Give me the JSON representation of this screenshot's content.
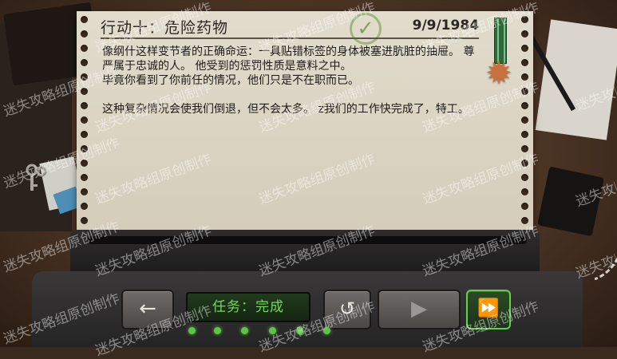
{
  "document": {
    "title": "行动十：危险药物",
    "date": "9/9/1984",
    "paragraphs": [
      "像纲什这样变节者的正确命运：一具贴错标签的身体被塞进肮脏的抽屉。 尊严属于忠诚的人。 他受到的惩罚性质是意料之中。",
      "毕竟你看到了你前任的情况，他们只是不在职而已。",
      "这种复杂情况会使我们倒退，但不会太多。 z我们的工作快完成了，特工。"
    ]
  },
  "printer": {
    "status": "任务：完成",
    "back_icon": "←",
    "replay_icon": "↺",
    "play_icon": "▶",
    "ff_icon": "⏩",
    "led_count": 6
  },
  "colors": {
    "status_green": "#76d85b",
    "ff_accent": "#5fd14a",
    "medal": "#c8713d"
  },
  "watermark": "迷失攻略组原创制作"
}
